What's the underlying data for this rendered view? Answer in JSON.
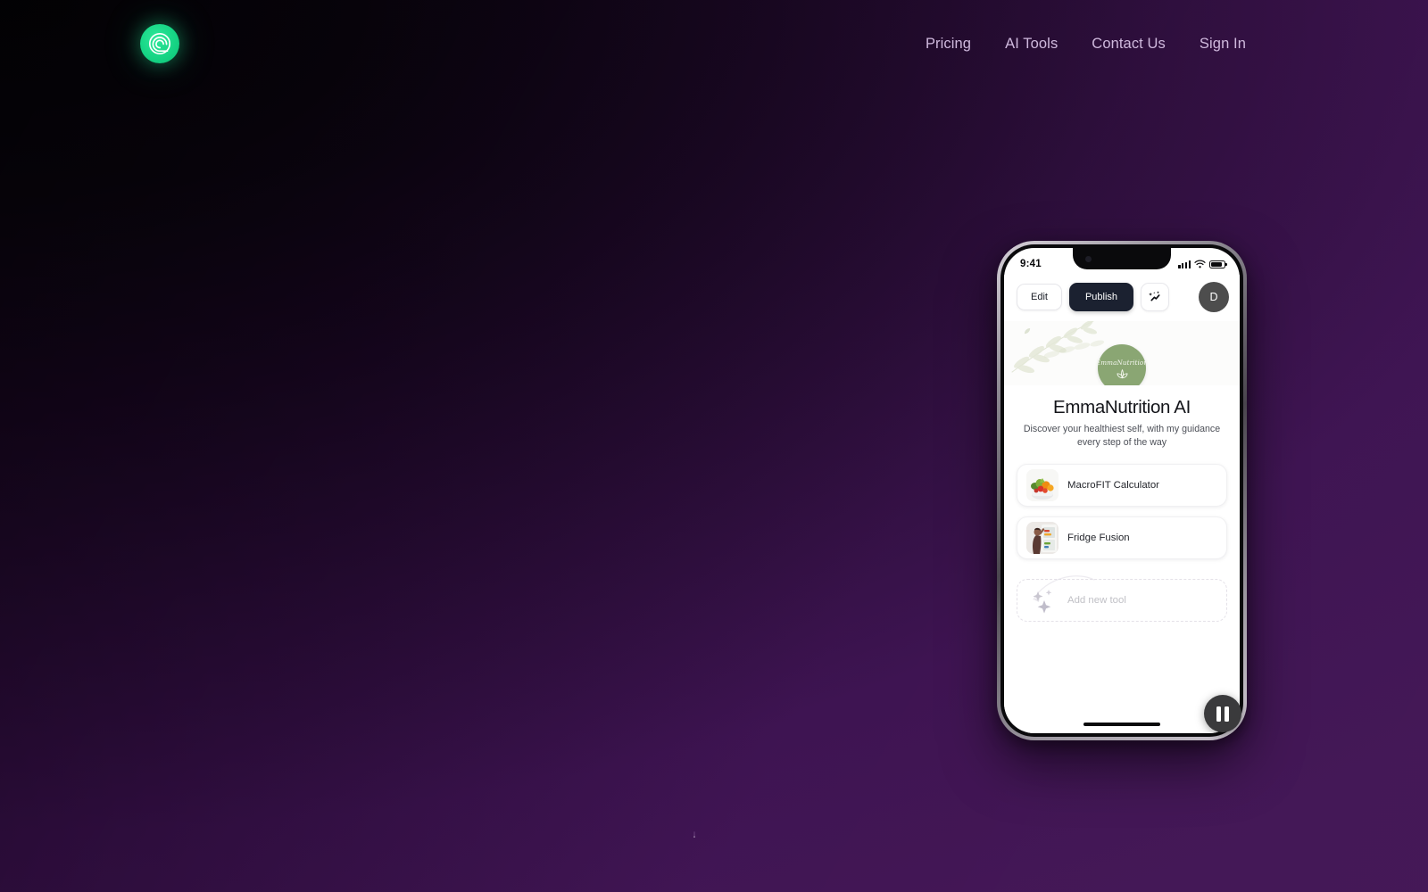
{
  "page": {
    "background_dark": "#0a0510",
    "background_purple": "#3d1150",
    "accent_green": "#1ed98c"
  },
  "header": {
    "logo": {
      "icon": "spiral-logo-icon",
      "alt": "Spiral brand logo"
    },
    "nav": [
      {
        "label": "Pricing"
      },
      {
        "label": "AI Tools"
      },
      {
        "label": "Contact Us"
      },
      {
        "label": "Sign In"
      }
    ]
  },
  "phone": {
    "status_bar": {
      "time": "9:41",
      "signal_icon": "cellular-signal-icon",
      "wifi_icon": "wifi-icon",
      "battery_icon": "battery-icon"
    },
    "toolbar": {
      "edit_label": "Edit",
      "publish_label": "Publish",
      "magic_icon": "magic-wand-sparkle-icon",
      "avatar_initial": "D"
    },
    "profile": {
      "avatar_text": "EmmaNutrition",
      "avatar_glyph": "lotus-leaf-icon",
      "avatar_color": "#8aa673",
      "title": "EmmaNutrition AI",
      "tagline": "Discover your healthiest self, with my guidance every step of the way"
    },
    "tools": [
      {
        "label": "MacroFIT Calculator",
        "thumb": "vegetable-bowl-photo"
      },
      {
        "label": "Fridge Fusion",
        "thumb": "person-at-fridge-photo"
      }
    ],
    "add_tool": {
      "label": "Add new tool",
      "icon": "sparkles-icon"
    },
    "home_indicator": "home-indicator-bar"
  },
  "overlay": {
    "pause_button": "pause-icon",
    "scroll_cue": "scroll-down-arrow-icon"
  }
}
